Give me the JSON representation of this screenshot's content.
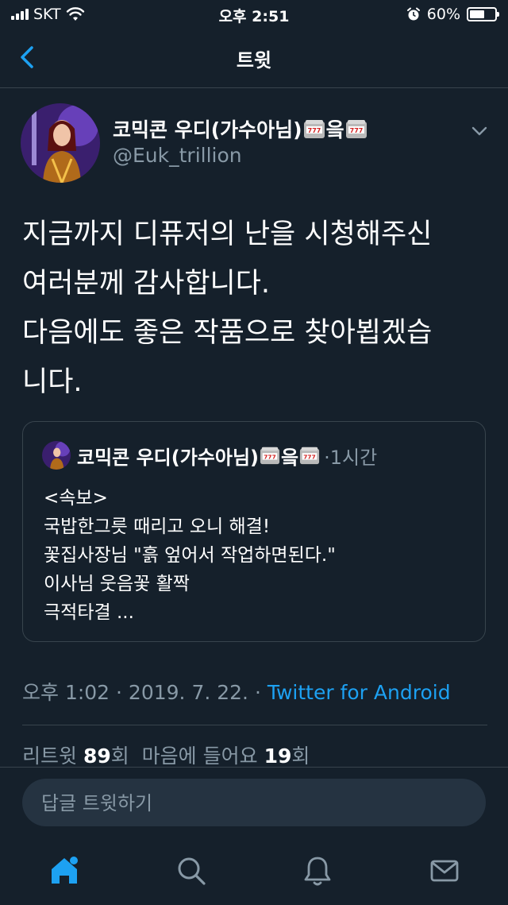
{
  "status_bar": {
    "carrier": "SKT",
    "time": "오후 2:51",
    "battery": "60%",
    "battery_level": 0.6
  },
  "header": {
    "title": "트윗"
  },
  "tweet": {
    "author_name": "코믹콘 우디(가수아님)",
    "name_suffix": "읔",
    "handle": "@Euk_trillion",
    "text": "지금까지 디퓨저의 난을 시청해주신\n여러분께 감사합니다.\n다음에도 좋은 작품으로 찾아뵙겠습\n니다.",
    "timestamp": "오후 1:02 · 2019. 7. 22. · ",
    "source": "Twitter for Android",
    "retweets_label": "리트윗 ",
    "retweets_count": "89",
    "retweets_unit": "회",
    "likes_label": "마음에 들어요 ",
    "likes_count": "19",
    "likes_unit": "회"
  },
  "quoted_tweet": {
    "author_name": "코믹콘 우디(가수아님)",
    "name_suffix": "읔",
    "time": "·1시간",
    "text": "<속보>\n국밥한그릇 때리고 오니 해결!\n꽃집사장님 \"흙 엎어서 작업하면된다.\"\n이사님 웃음꽃 활짝\n극적타결 ..."
  },
  "reply": {
    "placeholder": "답글 트윗하기"
  },
  "colors": {
    "background": "#15202b",
    "accent": "#1da1f2",
    "muted": "#8899a6",
    "border": "#38444d"
  },
  "icons": [
    "back-chevron-icon",
    "caret-down-icon",
    "slot-machine-icon",
    "home-icon",
    "search-icon",
    "notifications-bell-icon",
    "messages-envelope-icon"
  ]
}
